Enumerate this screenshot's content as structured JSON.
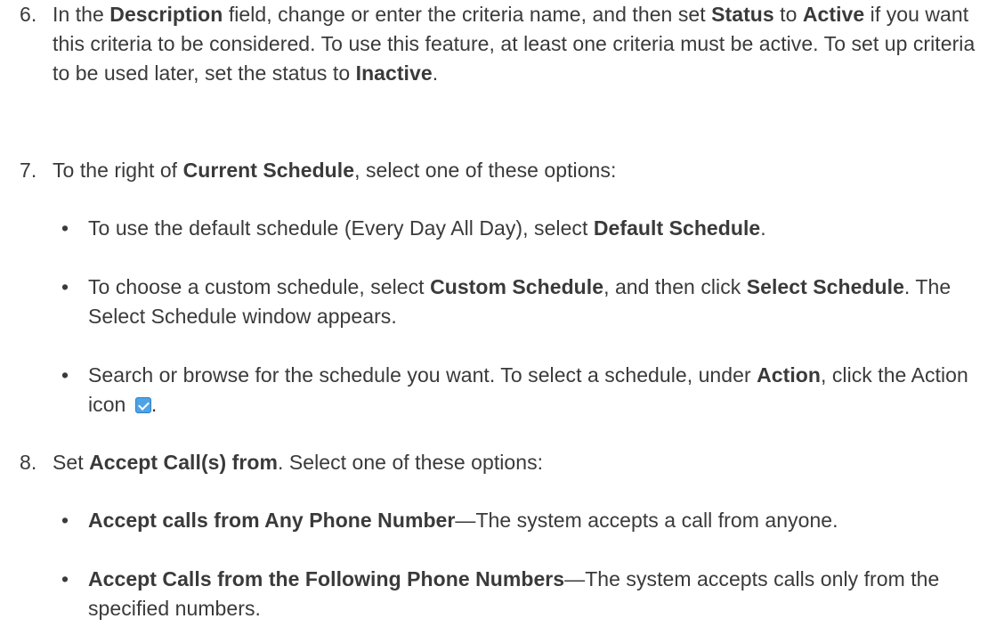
{
  "steps": [
    {
      "number": "6.",
      "parts": [
        {
          "t": "In the ",
          "b": false
        },
        {
          "t": "Description",
          "b": true
        },
        {
          "t": " field, change or enter the criteria name, and then set ",
          "b": false
        },
        {
          "t": "Status",
          "b": true
        },
        {
          "t": " to ",
          "b": false
        },
        {
          "t": "Active",
          "b": true
        },
        {
          "t": " if you want this criteria to be considered. To use this feature, at least one criteria must be active. To set up criteria to be used later, set the status to ",
          "b": false
        },
        {
          "t": "Inactive",
          "b": true
        },
        {
          "t": ".",
          "b": false
        }
      ]
    },
    {
      "number": "7.",
      "parts": [
        {
          "t": "To the right of ",
          "b": false
        },
        {
          "t": "Current Schedule",
          "b": true
        },
        {
          "t": ", select one of these options:",
          "b": false
        }
      ],
      "bullets": [
        {
          "parts": [
            {
              "t": "To use the default schedule (Every Day All Day), select ",
              "b": false
            },
            {
              "t": "Default Schedule",
              "b": true
            },
            {
              "t": ".",
              "b": false
            }
          ]
        },
        {
          "parts": [
            {
              "t": "To choose a custom schedule, select ",
              "b": false
            },
            {
              "t": "Custom Schedule",
              "b": true
            },
            {
              "t": ", and then click ",
              "b": false
            },
            {
              "t": "Select Schedule",
              "b": true
            },
            {
              "t": ". The Select Schedule window appears.",
              "b": false
            }
          ]
        },
        {
          "parts": [
            {
              "t": "Search or browse for the schedule you want. To select a schedule, under ",
              "b": false
            },
            {
              "t": "Action",
              "b": true
            },
            {
              "t": ", click the Action icon ",
              "b": false
            },
            {
              "icon": "action-checkbox-icon"
            },
            {
              "t": ".",
              "b": false
            }
          ]
        }
      ]
    },
    {
      "number": "8.",
      "parts": [
        {
          "t": "Set ",
          "b": false
        },
        {
          "t": "Accept Call(s) from",
          "b": true
        },
        {
          "t": ". Select one of these options:",
          "b": false
        }
      ],
      "bullets": [
        {
          "parts": [
            {
              "t": "Accept calls from Any Phone Number",
              "b": true
            },
            {
              "t": "—The system accepts a call from anyone.",
              "b": false
            }
          ]
        },
        {
          "parts": [
            {
              "t": "Accept Calls from the Following Phone Numbers",
              "b": true
            },
            {
              "t": "—The system accepts calls only from the specified numbers.",
              "b": false
            }
          ]
        }
      ]
    }
  ],
  "bullet_glyph": "•",
  "colors": {
    "text": "#3a3a3a",
    "icon_fill": "#4ea3e6",
    "icon_border": "#2c7fc7"
  }
}
